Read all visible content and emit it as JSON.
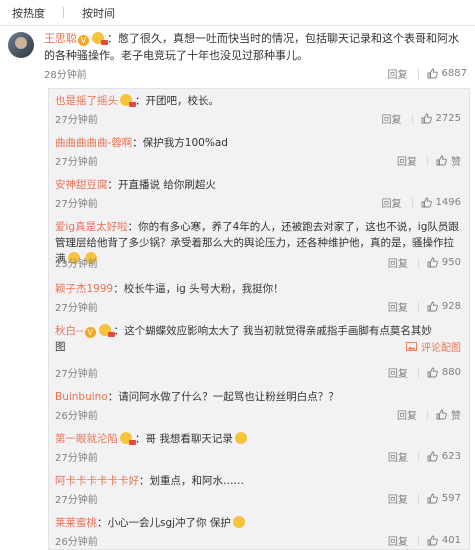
{
  "sort": {
    "hot": "按热度",
    "time": "按时间"
  },
  "main": {
    "user": "王思聪",
    "text": "：憋了很久，真想一吐而快当时的情况，包括聊天记录和这个表哥和阿水的各种骚操作。老子电竞玩了十年也没见过那种事儿。",
    "time": "28分钟前",
    "reply_label": "回复",
    "likes": "6887"
  },
  "replies": [
    {
      "user": "也是摇了摇头",
      "text": "：开团吧，校长。",
      "time": "27分钟前",
      "reply_label": "回复",
      "likes": "2725"
    },
    {
      "user": "曲曲曲曲曲-蓉啊",
      "text": "：保护我方100%ad",
      "time": "27分钟前",
      "reply_label": "回复",
      "likes": "赞"
    },
    {
      "user": "安神甜豆腐",
      "text": "：开直播说 给你刷超火",
      "time": "27分钟前",
      "reply_label": "回复",
      "likes": "1496"
    },
    {
      "user": "爱ig真是太好啦",
      "text": "：你的有多心寒，养了4年的人，还被跑去对家了，这也不说，ig队员跟管理层给他背了多少锅？承受着那么大的舆论压力，还各种维护他，真的是，骚操作拉满",
      "time": "23分钟前",
      "reply_label": "回复",
      "likes": "950"
    },
    {
      "user": "颖子杰1999",
      "text": "：校长牛逼，ig 头号大粉，我挺你！",
      "time": "27分钟前",
      "reply_label": "回复",
      "likes": "928"
    },
    {
      "user": "秋白--",
      "text": "：这个蝴蝶效应影响太大了 我当初就觉得亲戚指手画脚有点莫名其妙",
      "tail": "图",
      "time": "27分钟前",
      "comment_pic": "评论配图",
      "likes": ""
    },
    {
      "user": "",
      "text": "",
      "time": "27分钟前",
      "reply_label": "回复",
      "likes": "880"
    },
    {
      "user": "Buinbuino",
      "text": "：请问阿水做了什么？一起骂也让粉丝明白点？？",
      "time": "26分钟前",
      "reply_label": "回复",
      "likes": "赞"
    },
    {
      "user": "第一眼就沦陷",
      "text": "：哥 我想看聊天记录",
      "time": "27分钟前",
      "reply_label": "回复",
      "likes": "623"
    },
    {
      "user": "阿卡卡卡卡卡卡好",
      "text": "：划重点，和阿水……",
      "time": "27分钟前",
      "reply_label": "回复",
      "likes": "597"
    },
    {
      "user": "莱莱蜜桃",
      "text": "：小心一会儿sgj冲了你 保护",
      "time": "26分钟前",
      "reply_label": "回复",
      "likes": "401"
    }
  ],
  "colors": {
    "username": "#eb7350",
    "meta": "#808080",
    "reply_bg": "#f2f2f5"
  },
  "icons": {
    "like": "thumbs-up-icon",
    "verified": "v-badge-icon",
    "emoji": "emoji-icon",
    "image": "image-icon"
  }
}
